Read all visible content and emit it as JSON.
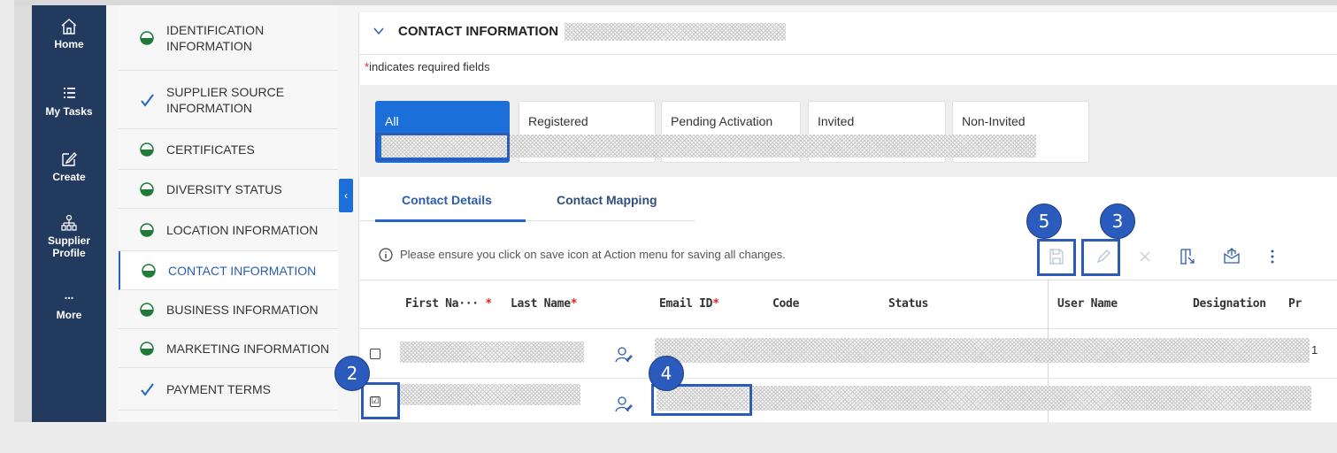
{
  "rail": {
    "items": [
      {
        "label": "Home",
        "icon": "home-icon"
      },
      {
        "label": "My Tasks",
        "icon": "list-icon"
      },
      {
        "label": "Create",
        "icon": "edit-icon"
      },
      {
        "label": "Supplier Profile",
        "icon": "org-icon"
      },
      {
        "label": "More",
        "icon": "more-icon"
      }
    ]
  },
  "sections": {
    "items": [
      {
        "label": "IDENTIFICATION INFORMATION",
        "state": "partial"
      },
      {
        "label": "SUPPLIER SOURCE INFORMATION",
        "state": "done"
      },
      {
        "label": "CERTIFICATES",
        "state": "partial"
      },
      {
        "label": "DIVERSITY STATUS",
        "state": "partial"
      },
      {
        "label": "LOCATION INFORMATION",
        "state": "partial"
      },
      {
        "label": "CONTACT INFORMATION",
        "state": "partial"
      },
      {
        "label": "BUSINESS INFORMATION",
        "state": "partial"
      },
      {
        "label": "MARKETING INFORMATION",
        "state": "partial"
      },
      {
        "label": "PAYMENT TERMS",
        "state": "done"
      }
    ]
  },
  "main": {
    "title": "CONTACT INFORMATION",
    "required_prefix": "*",
    "required_text": "indicates required fields",
    "filters": [
      "All",
      "Registered",
      "Pending Activation",
      "Invited",
      "Non-Invited"
    ],
    "subtabs": [
      "Contact Details",
      "Contact Mapping"
    ],
    "info_message": "Please ensure you click on save icon at Action menu for saving all changes.",
    "columns": {
      "first_name": "First Na···",
      "first_name_star": "*",
      "last_name": "Last Name",
      "last_name_star": "*",
      "email": "Email ID",
      "email_star": "*",
      "code": "Code",
      "status": "Status",
      "user_name": "User Name",
      "designation": "Designation",
      "pr": "Pr"
    },
    "row1_tail": "1",
    "row2_check": "☑"
  },
  "badges": {
    "b2": "2",
    "b3": "3",
    "b4": "4",
    "b5": "5"
  },
  "colors": {
    "accent": "#1c6ed8",
    "rail": "#223a5e",
    "badge": "#2a5bbd",
    "required": "#e02424"
  }
}
